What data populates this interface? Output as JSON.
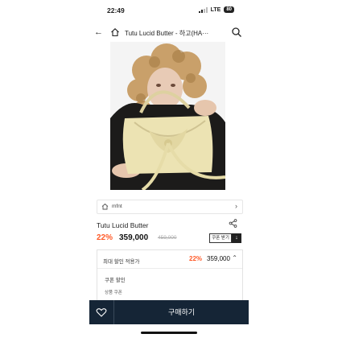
{
  "status": {
    "time": "22:49",
    "network": "LTE",
    "battery": "80"
  },
  "header": {
    "title": "Tutu Lucid Butter - 하고(HA···"
  },
  "product": {
    "seller": "mfnt",
    "name": "Tutu Lucid Butter",
    "discount": "22%",
    "price": "359,000",
    "original_price": "459,000",
    "coupon_label": "쿠폰 받기"
  },
  "benefit": {
    "label": "최대 할인 적용가",
    "discount": "22%",
    "price": "359,000",
    "coupon_title": "쿠폰 할인",
    "coupon_item": "상품 쿠폰"
  },
  "bottom": {
    "buy_label": "구매하기"
  },
  "colors": {
    "accent": "#ff5a28",
    "bar": "#152536",
    "bag": "#ece3b3"
  }
}
